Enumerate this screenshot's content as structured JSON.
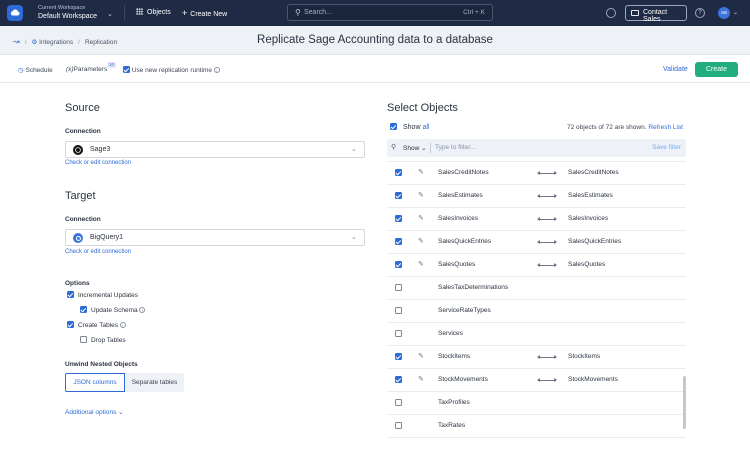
{
  "topbar": {
    "workspace_label": "Current Workspace",
    "workspace_name": "Default Workspace",
    "objects_label": "Objects",
    "create_new_label": "Create New",
    "search_placeholder": "Search...",
    "search_shortcut": "Ctrl + K",
    "contact_sales_label": "Contact Sales",
    "avatar_initials": "SB"
  },
  "breadcrumb": {
    "integrations": "Integrations",
    "replication": "Replication"
  },
  "page_title": "Replicate Sage Accounting data to a database",
  "toolbar": {
    "schedule_label": "Schedule",
    "parameters_prefix": "(x)",
    "parameters_label": "Parameters",
    "parameters_badge": "10",
    "runtime_label": "Use new replication runtime",
    "validate_label": "Validate",
    "create_label": "Create"
  },
  "source": {
    "heading": "Source",
    "connection_label": "Connection",
    "connection_value": "Sage3",
    "edit_link": "Check or edit connection"
  },
  "target": {
    "heading": "Target",
    "connection_label": "Connection",
    "connection_value": "BigQuery1",
    "edit_link": "Check or edit connection"
  },
  "options": {
    "heading": "Options",
    "incremental_updates": "Incremental Updates",
    "update_schema": "Update Schema",
    "create_tables": "Create Tables",
    "drop_tables": "Drop Tables"
  },
  "unwind": {
    "heading": "Unwind Nested Objects",
    "json_columns": "JSON columns",
    "separate_tables": "Separate tables"
  },
  "additional_options": "Additional options",
  "objects": {
    "heading": "Select Objects",
    "show_label": "Show",
    "show_all_link": "all",
    "count_text": "72 objects of 72 are shown.",
    "refresh_label": "Refresh List",
    "filter_show": "Show",
    "filter_placeholder": "Type to filter...",
    "save_filter": "Save filter",
    "rows": [
      {
        "name": "SalesCreditNotes",
        "target": "SalesCreditNotes",
        "checked": true
      },
      {
        "name": "SalesEstimates",
        "target": "SalesEstimates",
        "checked": true
      },
      {
        "name": "SalesInvoices",
        "target": "SalesInvoices",
        "checked": true
      },
      {
        "name": "SalesQuickEntries",
        "target": "SalesQuickEntries",
        "checked": true
      },
      {
        "name": "SalesQuotes",
        "target": "SalesQuotes",
        "checked": true
      },
      {
        "name": "SalesTaxDeterminations",
        "target": "",
        "checked": false
      },
      {
        "name": "ServiceRateTypes",
        "target": "",
        "checked": false
      },
      {
        "name": "Services",
        "target": "",
        "checked": false
      },
      {
        "name": "StockItems",
        "target": "StockItems",
        "checked": true
      },
      {
        "name": "StockMovements",
        "target": "StockMovements",
        "checked": true
      },
      {
        "name": "TaxProfiles",
        "target": "",
        "checked": false
      },
      {
        "name": "TaxRates",
        "target": "",
        "checked": false
      }
    ]
  }
}
